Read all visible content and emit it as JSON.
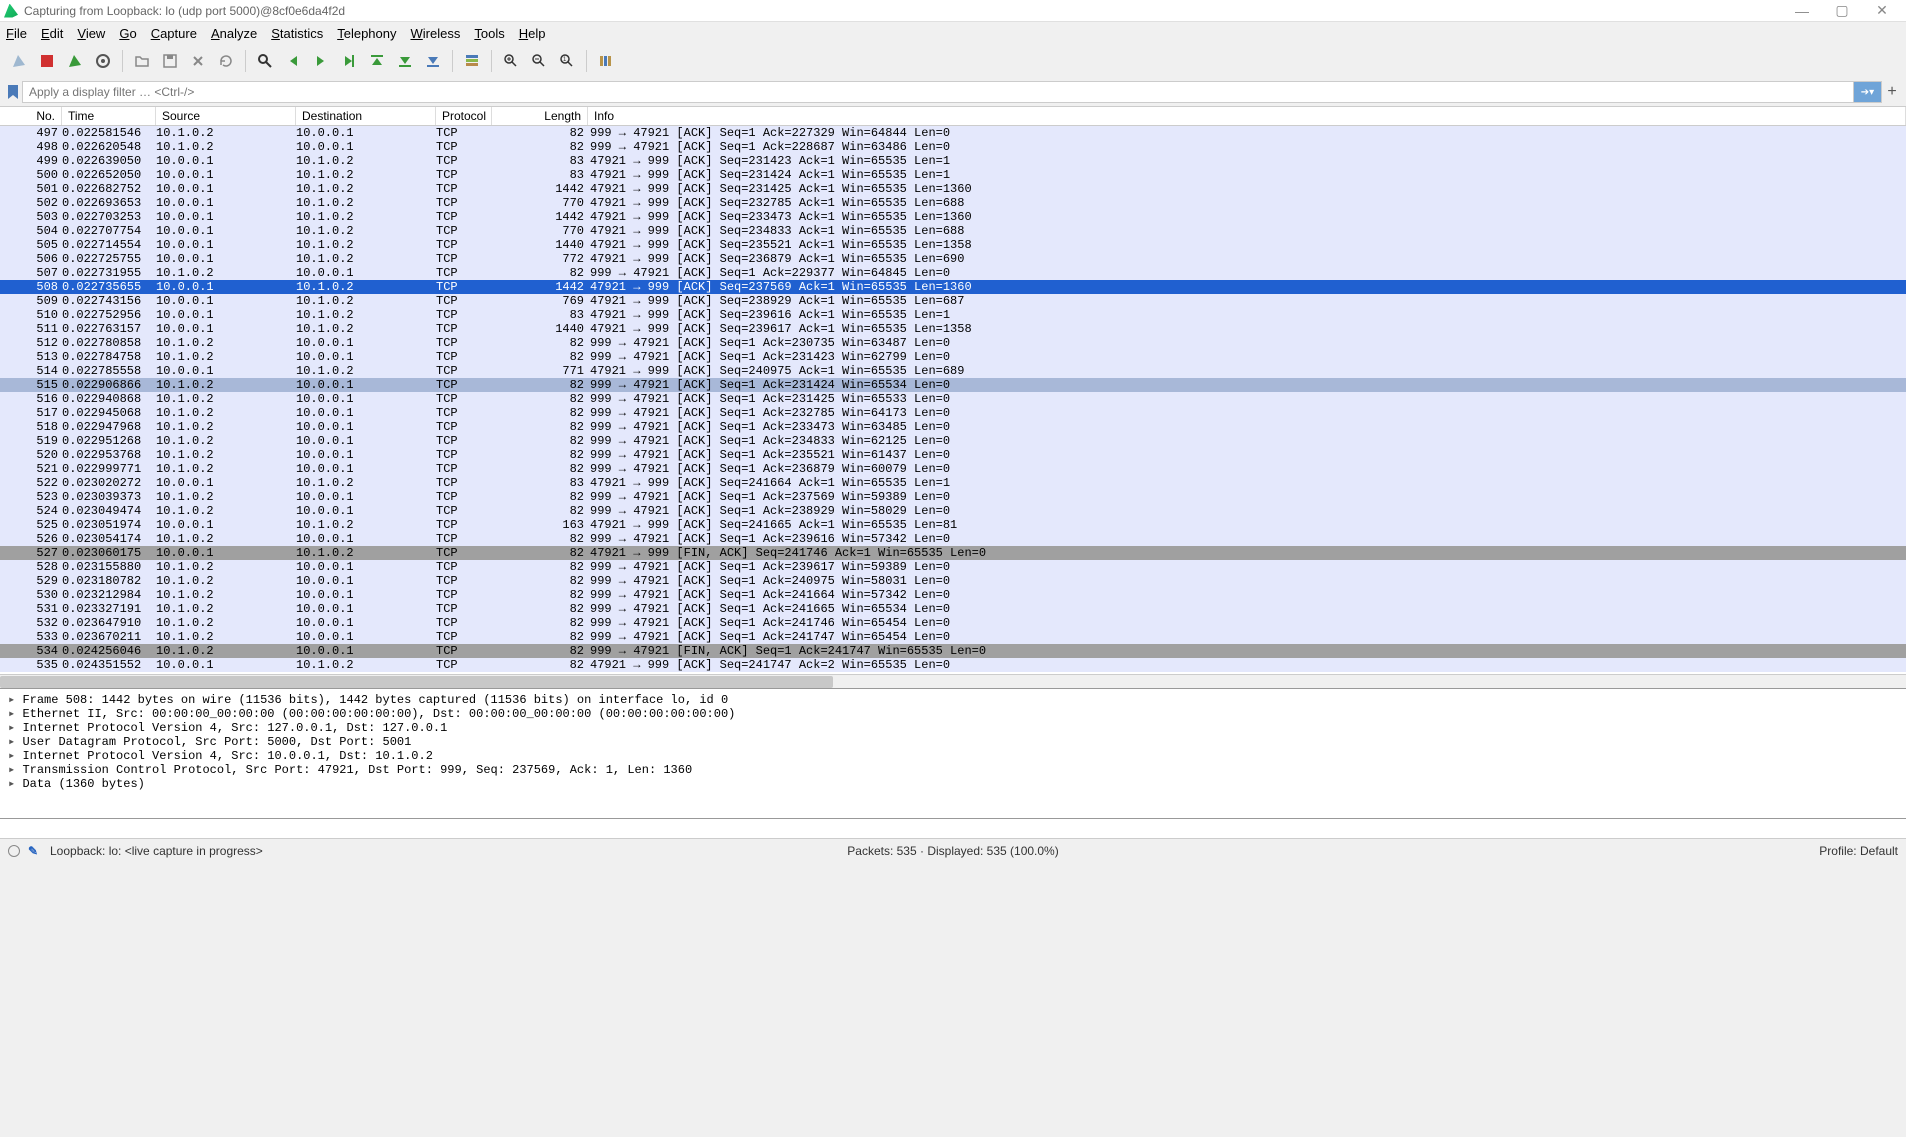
{
  "window": {
    "title": "Capturing from Loopback: lo (udp port 5000)@8cf0e6da4f2d"
  },
  "menu": [
    "File",
    "Edit",
    "View",
    "Go",
    "Capture",
    "Analyze",
    "Statistics",
    "Telephony",
    "Wireless",
    "Tools",
    "Help"
  ],
  "filter": {
    "placeholder": "Apply a display filter … <Ctrl-/>"
  },
  "columns": [
    "No.",
    "Time",
    "Source",
    "Destination",
    "Protocol",
    "Length",
    "Info"
  ],
  "packets": [
    {
      "no": 497,
      "time": "0.022581546",
      "src": "10.1.0.2",
      "dst": "10.0.0.1",
      "proto": "TCP",
      "len": 82,
      "info": "999 → 47921 [ACK] Seq=1 Ack=227329 Win=64844 Len=0"
    },
    {
      "no": 498,
      "time": "0.022620548",
      "src": "10.1.0.2",
      "dst": "10.0.0.1",
      "proto": "TCP",
      "len": 82,
      "info": "999 → 47921 [ACK] Seq=1 Ack=228687 Win=63486 Len=0"
    },
    {
      "no": 499,
      "time": "0.022639050",
      "src": "10.0.0.1",
      "dst": "10.1.0.2",
      "proto": "TCP",
      "len": 83,
      "info": "47921 → 999 [ACK] Seq=231423 Ack=1 Win=65535 Len=1"
    },
    {
      "no": 500,
      "time": "0.022652050",
      "src": "10.0.0.1",
      "dst": "10.1.0.2",
      "proto": "TCP",
      "len": 83,
      "info": "47921 → 999 [ACK] Seq=231424 Ack=1 Win=65535 Len=1"
    },
    {
      "no": 501,
      "time": "0.022682752",
      "src": "10.0.0.1",
      "dst": "10.1.0.2",
      "proto": "TCP",
      "len": 1442,
      "info": "47921 → 999 [ACK] Seq=231425 Ack=1 Win=65535 Len=1360"
    },
    {
      "no": 502,
      "time": "0.022693653",
      "src": "10.0.0.1",
      "dst": "10.1.0.2",
      "proto": "TCP",
      "len": 770,
      "info": "47921 → 999 [ACK] Seq=232785 Ack=1 Win=65535 Len=688"
    },
    {
      "no": 503,
      "time": "0.022703253",
      "src": "10.0.0.1",
      "dst": "10.1.0.2",
      "proto": "TCP",
      "len": 1442,
      "info": "47921 → 999 [ACK] Seq=233473 Ack=1 Win=65535 Len=1360"
    },
    {
      "no": 504,
      "time": "0.022707754",
      "src": "10.0.0.1",
      "dst": "10.1.0.2",
      "proto": "TCP",
      "len": 770,
      "info": "47921 → 999 [ACK] Seq=234833 Ack=1 Win=65535 Len=688"
    },
    {
      "no": 505,
      "time": "0.022714554",
      "src": "10.0.0.1",
      "dst": "10.1.0.2",
      "proto": "TCP",
      "len": 1440,
      "info": "47921 → 999 [ACK] Seq=235521 Ack=1 Win=65535 Len=1358"
    },
    {
      "no": 506,
      "time": "0.022725755",
      "src": "10.0.0.1",
      "dst": "10.1.0.2",
      "proto": "TCP",
      "len": 772,
      "info": "47921 → 999 [ACK] Seq=236879 Ack=1 Win=65535 Len=690"
    },
    {
      "no": 507,
      "time": "0.022731955",
      "src": "10.1.0.2",
      "dst": "10.0.0.1",
      "proto": "TCP",
      "len": 82,
      "info": "999 → 47921 [ACK] Seq=1 Ack=229377 Win=64845 Len=0"
    },
    {
      "no": 508,
      "time": "0.022735655",
      "src": "10.0.0.1",
      "dst": "10.1.0.2",
      "proto": "TCP",
      "len": 1442,
      "info": "47921 → 999 [ACK] Seq=237569 Ack=1 Win=65535 Len=1360",
      "sel": true
    },
    {
      "no": 509,
      "time": "0.022743156",
      "src": "10.0.0.1",
      "dst": "10.1.0.2",
      "proto": "TCP",
      "len": 769,
      "info": "47921 → 999 [ACK] Seq=238929 Ack=1 Win=65535 Len=687"
    },
    {
      "no": 510,
      "time": "0.022752956",
      "src": "10.0.0.1",
      "dst": "10.1.0.2",
      "proto": "TCP",
      "len": 83,
      "info": "47921 → 999 [ACK] Seq=239616 Ack=1 Win=65535 Len=1"
    },
    {
      "no": 511,
      "time": "0.022763157",
      "src": "10.0.0.1",
      "dst": "10.1.0.2",
      "proto": "TCP",
      "len": 1440,
      "info": "47921 → 999 [ACK] Seq=239617 Ack=1 Win=65535 Len=1358"
    },
    {
      "no": 512,
      "time": "0.022780858",
      "src": "10.1.0.2",
      "dst": "10.0.0.1",
      "proto": "TCP",
      "len": 82,
      "info": "999 → 47921 [ACK] Seq=1 Ack=230735 Win=63487 Len=0"
    },
    {
      "no": 513,
      "time": "0.022784758",
      "src": "10.1.0.2",
      "dst": "10.0.0.1",
      "proto": "TCP",
      "len": 82,
      "info": "999 → 47921 [ACK] Seq=1 Ack=231423 Win=62799 Len=0"
    },
    {
      "no": 514,
      "time": "0.022785558",
      "src": "10.0.0.1",
      "dst": "10.1.0.2",
      "proto": "TCP",
      "len": 771,
      "info": "47921 → 999 [ACK] Seq=240975 Ack=1 Win=65535 Len=689"
    },
    {
      "no": 515,
      "time": "0.022906866",
      "src": "10.1.0.2",
      "dst": "10.0.0.1",
      "proto": "TCP",
      "len": 82,
      "info": "999 → 47921 [ACK] Seq=1 Ack=231424 Win=65534 Len=0",
      "hl": true
    },
    {
      "no": 516,
      "time": "0.022940868",
      "src": "10.1.0.2",
      "dst": "10.0.0.1",
      "proto": "TCP",
      "len": 82,
      "info": "999 → 47921 [ACK] Seq=1 Ack=231425 Win=65533 Len=0"
    },
    {
      "no": 517,
      "time": "0.022945068",
      "src": "10.1.0.2",
      "dst": "10.0.0.1",
      "proto": "TCP",
      "len": 82,
      "info": "999 → 47921 [ACK] Seq=1 Ack=232785 Win=64173 Len=0"
    },
    {
      "no": 518,
      "time": "0.022947968",
      "src": "10.1.0.2",
      "dst": "10.0.0.1",
      "proto": "TCP",
      "len": 82,
      "info": "999 → 47921 [ACK] Seq=1 Ack=233473 Win=63485 Len=0"
    },
    {
      "no": 519,
      "time": "0.022951268",
      "src": "10.1.0.2",
      "dst": "10.0.0.1",
      "proto": "TCP",
      "len": 82,
      "info": "999 → 47921 [ACK] Seq=1 Ack=234833 Win=62125 Len=0"
    },
    {
      "no": 520,
      "time": "0.022953768",
      "src": "10.1.0.2",
      "dst": "10.0.0.1",
      "proto": "TCP",
      "len": 82,
      "info": "999 → 47921 [ACK] Seq=1 Ack=235521 Win=61437 Len=0"
    },
    {
      "no": 521,
      "time": "0.022999771",
      "src": "10.1.0.2",
      "dst": "10.0.0.1",
      "proto": "TCP",
      "len": 82,
      "info": "999 → 47921 [ACK] Seq=1 Ack=236879 Win=60079 Len=0"
    },
    {
      "no": 522,
      "time": "0.023020272",
      "src": "10.0.0.1",
      "dst": "10.1.0.2",
      "proto": "TCP",
      "len": 83,
      "info": "47921 → 999 [ACK] Seq=241664 Ack=1 Win=65535 Len=1"
    },
    {
      "no": 523,
      "time": "0.023039373",
      "src": "10.1.0.2",
      "dst": "10.0.0.1",
      "proto": "TCP",
      "len": 82,
      "info": "999 → 47921 [ACK] Seq=1 Ack=237569 Win=59389 Len=0"
    },
    {
      "no": 524,
      "time": "0.023049474",
      "src": "10.1.0.2",
      "dst": "10.0.0.1",
      "proto": "TCP",
      "len": 82,
      "info": "999 → 47921 [ACK] Seq=1 Ack=238929 Win=58029 Len=0"
    },
    {
      "no": 525,
      "time": "0.023051974",
      "src": "10.0.0.1",
      "dst": "10.1.0.2",
      "proto": "TCP",
      "len": 163,
      "info": "47921 → 999 [ACK] Seq=241665 Ack=1 Win=65535 Len=81"
    },
    {
      "no": 526,
      "time": "0.023054174",
      "src": "10.1.0.2",
      "dst": "10.0.0.1",
      "proto": "TCP",
      "len": 82,
      "info": "999 → 47921 [ACK] Seq=1 Ack=239616 Win=57342 Len=0"
    },
    {
      "no": 527,
      "time": "0.023060175",
      "src": "10.0.0.1",
      "dst": "10.1.0.2",
      "proto": "TCP",
      "len": 82,
      "info": "47921 → 999 [FIN, ACK] Seq=241746 Ack=1 Win=65535 Len=0",
      "fin": true
    },
    {
      "no": 528,
      "time": "0.023155880",
      "src": "10.1.0.2",
      "dst": "10.0.0.1",
      "proto": "TCP",
      "len": 82,
      "info": "999 → 47921 [ACK] Seq=1 Ack=239617 Win=59389 Len=0"
    },
    {
      "no": 529,
      "time": "0.023180782",
      "src": "10.1.0.2",
      "dst": "10.0.0.1",
      "proto": "TCP",
      "len": 82,
      "info": "999 → 47921 [ACK] Seq=1 Ack=240975 Win=58031 Len=0"
    },
    {
      "no": 530,
      "time": "0.023212984",
      "src": "10.1.0.2",
      "dst": "10.0.0.1",
      "proto": "TCP",
      "len": 82,
      "info": "999 → 47921 [ACK] Seq=1 Ack=241664 Win=57342 Len=0"
    },
    {
      "no": 531,
      "time": "0.023327191",
      "src": "10.1.0.2",
      "dst": "10.0.0.1",
      "proto": "TCP",
      "len": 82,
      "info": "999 → 47921 [ACK] Seq=1 Ack=241665 Win=65534 Len=0"
    },
    {
      "no": 532,
      "time": "0.023647910",
      "src": "10.1.0.2",
      "dst": "10.0.0.1",
      "proto": "TCP",
      "len": 82,
      "info": "999 → 47921 [ACK] Seq=1 Ack=241746 Win=65454 Len=0"
    },
    {
      "no": 533,
      "time": "0.023670211",
      "src": "10.1.0.2",
      "dst": "10.0.0.1",
      "proto": "TCP",
      "len": 82,
      "info": "999 → 47921 [ACK] Seq=1 Ack=241747 Win=65454 Len=0"
    },
    {
      "no": 534,
      "time": "0.024256046",
      "src": "10.1.0.2",
      "dst": "10.0.0.1",
      "proto": "TCP",
      "len": 82,
      "info": "999 → 47921 [FIN, ACK] Seq=1 Ack=241747 Win=65535 Len=0",
      "fin": true
    },
    {
      "no": 535,
      "time": "0.024351552",
      "src": "10.0.0.1",
      "dst": "10.1.0.2",
      "proto": "TCP",
      "len": 82,
      "info": "47921 → 999 [ACK] Seq=241747 Ack=2 Win=65535 Len=0"
    }
  ],
  "details": [
    "Frame 508: 1442 bytes on wire (11536 bits), 1442 bytes captured (11536 bits) on interface lo, id 0",
    "Ethernet II, Src: 00:00:00_00:00:00 (00:00:00:00:00:00), Dst: 00:00:00_00:00:00 (00:00:00:00:00:00)",
    "Internet Protocol Version 4, Src: 127.0.0.1, Dst: 127.0.0.1",
    "User Datagram Protocol, Src Port: 5000, Dst Port: 5001",
    "Internet Protocol Version 4, Src: 10.0.0.1, Dst: 10.1.0.2",
    "Transmission Control Protocol, Src Port: 47921, Dst Port: 999, Seq: 237569, Ack: 1, Len: 1360",
    "Data (1360 bytes)"
  ],
  "status": {
    "left": "Loopback: lo: <live capture in progress>",
    "mid": "Packets: 535 · Displayed: 535 (100.0%)",
    "right": "Profile: Default"
  }
}
